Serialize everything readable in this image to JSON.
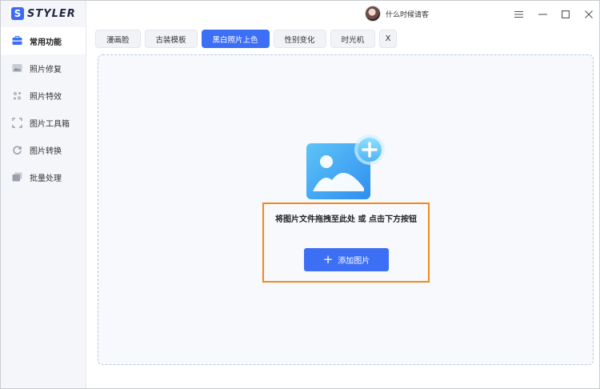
{
  "app": {
    "logo_letter": "S",
    "logo_text": "STYLER"
  },
  "user": {
    "name": "什么时候请客"
  },
  "window_controls": [
    "menu-icon",
    "minimize-icon",
    "maximize-icon",
    "close-icon"
  ],
  "sidebar": {
    "items": [
      {
        "label": "常用功能",
        "icon": "toolbox-icon",
        "active": true
      },
      {
        "label": "照片修复",
        "icon": "photo-repair-icon",
        "active": false
      },
      {
        "label": "照片特效",
        "icon": "sparkle-icon",
        "active": false
      },
      {
        "label": "图片工具箱",
        "icon": "crop-frame-icon",
        "active": false
      },
      {
        "label": "图片转换",
        "icon": "convert-icon",
        "active": false
      },
      {
        "label": "批量处理",
        "icon": "batch-icon",
        "active": false
      }
    ]
  },
  "tabs": [
    {
      "label": "漫画脸",
      "active": false
    },
    {
      "label": "古装模板",
      "active": false
    },
    {
      "label": "黑白照片上色",
      "active": true
    },
    {
      "label": "性别变化",
      "active": false
    },
    {
      "label": "时光机",
      "active": false
    }
  ],
  "tabs_close": "X",
  "dropzone": {
    "hint": "将图片文件拖拽至此处 或 点击下方按钮",
    "button_label": "添加图片",
    "button_icon": "plus-icon"
  },
  "colors": {
    "accent": "#3d6ff5",
    "highlight": "#f08a1c",
    "sidebar_bg": "#f4f6f9"
  }
}
